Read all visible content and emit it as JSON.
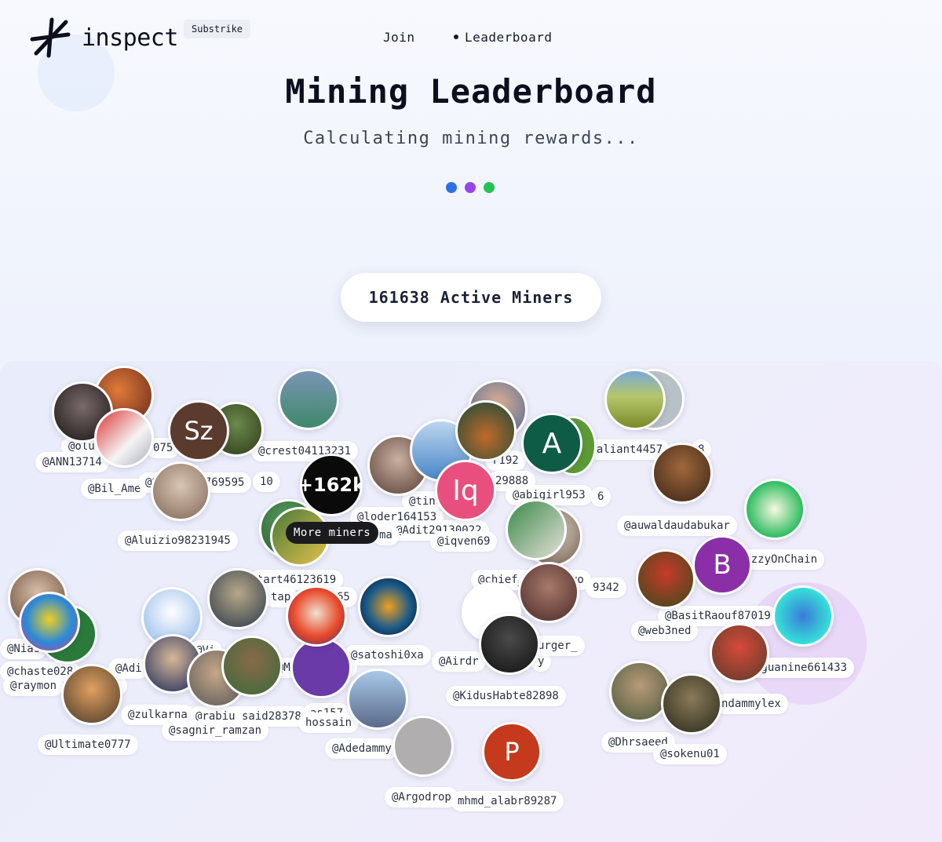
{
  "brand": {
    "name": "inspect",
    "badge": "Substrike"
  },
  "nav": {
    "join": "Join",
    "leaderboard": "Leaderboard"
  },
  "hero": {
    "title": "Mining Leaderboard",
    "subtitle": "Calculating mining rewards...",
    "loader_colors": [
      "#2f6fe3",
      "#9646e8",
      "#26c256"
    ]
  },
  "active_miners": "161638 Active Miners",
  "more": {
    "count": "+162k",
    "label": "More miners"
  },
  "avatar_letters": {
    "sz": "Sz",
    "iq": "Iq",
    "a": "A",
    "b": "B",
    "p": "P"
  },
  "miners": [
    "@olu",
    "@ANN13714",
    "075",
    "@Bil_Ame",
    "@Szymon14769595",
    "10",
    "@crest04113231",
    "@Aluizio98231945",
    "@loder164153",
    "@tin",
    "@Adit29130022",
    "ma",
    "r192",
    "29888",
    "@abigirl953",
    "6",
    "@iqven69",
    "@valiant4457",
    "8",
    "@auwaldaudabukar",
    "@SwizzyOnChain",
    "@chief___goronyo",
    "9342",
    "tart46123619",
    "tap",
    "65",
    "@BasitRaouf87019",
    "@web3ned",
    "@Nias",
    "@chaste028",
    "@raymon",
    "6",
    "@Adi",
    "@Vi",
    "@satoshi0xa",
    "@Morleydi21",
    "@Airdr",
    "y",
    "urger_",
    "@guanine661433",
    "@zulkarna",
    "@rabiu_said28378",
    "as157",
    "@sagnir_ramzan",
    "hossain",
    "@KidusHabte82898",
    "ndammylex",
    "@Ultimate0777",
    "@Adedammy",
    "@Dhrsaeed",
    "@sokenu01",
    "@Argodrop",
    "mhmd_alabr89287"
  ]
}
